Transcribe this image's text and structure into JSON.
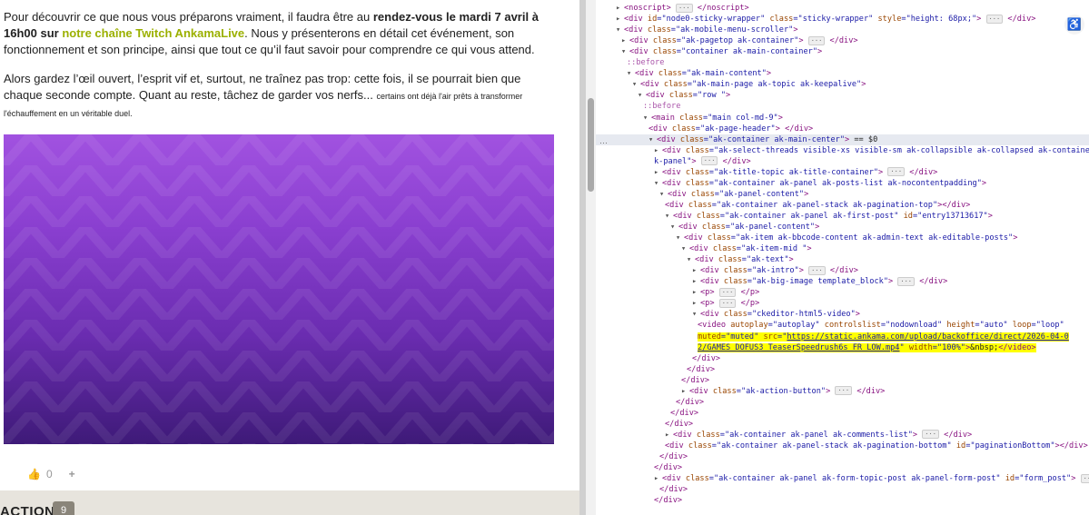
{
  "article": {
    "p1_a": "Pour découvrir ce que nous vous préparons vraiment, il faudra être au ",
    "p1_bold": "rendez-vous le mardi 7 avril à 16h00 sur",
    "p1_link": " notre chaîne Twitch AnkamaLive",
    "p1_b": ". Nous y présenterons en détail cet événement, son fonctionnement et son principe, ainsi que tout ce qu’il faut savoir pour comprendre ce qui vous attend.",
    "p2_a": "Alors gardez l’œil ouvert, l’esprit vif et, surtout, ne traînez pas trop: cette fois, il se pourrait bien que chaque seconde compte. Quant au reste, tâchez de garder vos nerfs... ",
    "p2_small": "certains ont déjà l'air prêts à transformer l'échauffement en un véritable duel."
  },
  "likes": {
    "count": "0",
    "plus": "+"
  },
  "actions": {
    "label": "ACTIONS",
    "count": "9"
  },
  "devtools": {
    "lines": [
      {
        "indent": 0,
        "html": "<span class='arrow'>▸</span><span class='tag'>&lt;noscript&gt;</span> <span class='ell'>···</span> <span class='tag'>&lt;/noscript&gt;</span>"
      },
      {
        "indent": 0,
        "html": "<span class='arrow'>▸</span><span class='tag'>&lt;div</span> <span class='attr'>id</span>=<span class='val'>\"node0-sticky-wrapper\"</span> <span class='attr'>class</span>=<span class='val'>\"sticky-wrapper\"</span> <span class='attr'>style</span>=<span class='val'>\"height: 68px;\"</span><span class='tag'>&gt;</span> <span class='ell'>···</span> <span class='tag'>&lt;/div&gt;</span>"
      },
      {
        "indent": 0,
        "html": "<span class='arrow'>▾</span><span class='tag'>&lt;div</span> <span class='attr'>class</span>=<span class='val'>\"ak-mobile-menu-scroller\"</span><span class='tag'>&gt;</span>"
      },
      {
        "indent": 1,
        "html": "<span class='arrow'>▸</span><span class='tag'>&lt;div</span> <span class='attr'>class</span>=<span class='val'>\"ak-pagetop ak-container\"</span><span class='tag'>&gt;</span> <span class='ell'>···</span> <span class='tag'>&lt;/div&gt;</span>"
      },
      {
        "indent": 1,
        "html": "<span class='arrow'>▾</span><span class='tag'>&lt;div</span> <span class='attr'>class</span>=<span class='val'>\"container ak-main-container\"</span><span class='tag'>&gt;</span>"
      },
      {
        "indent": 2,
        "html": "<span class='pseudo'>::before</span>"
      },
      {
        "indent": 2,
        "html": "<span class='arrow'>▾</span><span class='tag'>&lt;div</span> <span class='attr'>class</span>=<span class='val'>\"ak-main-content\"</span><span class='tag'>&gt;</span>"
      },
      {
        "indent": 3,
        "html": "<span class='arrow'>▾</span><span class='tag'>&lt;div</span> <span class='attr'>class</span>=<span class='val'>\"ak-main-page ak-topic ak-keepalive\"</span><span class='tag'>&gt;</span>"
      },
      {
        "indent": 4,
        "html": "<span class='arrow'>▾</span><span class='tag'>&lt;div</span> <span class='attr'>class</span>=<span class='val'>\"row \"</span><span class='tag'>&gt;</span>"
      },
      {
        "indent": 5,
        "html": "<span class='pseudo'>::before</span>"
      },
      {
        "indent": 5,
        "html": "<span class='arrow'>▾</span><span class='tag'>&lt;main</span> <span class='attr'>class</span>=<span class='val'>\"main col-md-9\"</span><span class='tag'>&gt;</span>"
      },
      {
        "indent": 6,
        "html": "<span class='tag'>&lt;div</span> <span class='attr'>class</span>=<span class='val'>\"ak-page-header\"</span><span class='tag'>&gt;</span> <span class='tag'>&lt;/div&gt;</span>"
      },
      {
        "indent": 6,
        "sel": true,
        "html": "<span class='arrow'>▾</span><span class='tag'>&lt;div</span> <span class='attr'>class</span>=<span class='val'>\"ak-container ak-main-center\"</span><span class='tag'>&gt;</span> <span class='txt'>== $0</span>"
      },
      {
        "indent": 7,
        "html": "<span class='arrow'>▸</span><span class='tag'>&lt;div</span> <span class='attr'>class</span>=<span class='val'>\"ak-select-threads visible-xs visible-sm ak-collapsible ak-collapsed ak-container a</span>"
      },
      {
        "indent": 7,
        "html": "<span class='val'>k-panel\"</span><span class='tag'>&gt;</span> <span class='ell'>···</span> <span class='tag'>&lt;/div&gt;</span>"
      },
      {
        "indent": 7,
        "html": "<span class='arrow'>▸</span><span class='tag'>&lt;div</span> <span class='attr'>class</span>=<span class='val'>\"ak-title-topic ak-title-container\"</span><span class='tag'>&gt;</span> <span class='ell'>···</span> <span class='tag'>&lt;/div&gt;</span>"
      },
      {
        "indent": 7,
        "html": "<span class='arrow'>▾</span><span class='tag'>&lt;div</span> <span class='attr'>class</span>=<span class='val'>\"ak-container ak-panel ak-posts-list ak-nocontentpadding\"</span><span class='tag'>&gt;</span>"
      },
      {
        "indent": 8,
        "html": "<span class='arrow'>▾</span><span class='tag'>&lt;div</span> <span class='attr'>class</span>=<span class='val'>\"ak-panel-content\"</span><span class='tag'>&gt;</span>"
      },
      {
        "indent": 9,
        "html": "<span class='tag'>&lt;div</span> <span class='attr'>class</span>=<span class='val'>\"ak-container ak-panel-stack ak-pagination-top\"</span><span class='tag'>&gt;&lt;/div&gt;</span>"
      },
      {
        "indent": 9,
        "html": "<span class='arrow'>▾</span><span class='tag'>&lt;div</span> <span class='attr'>class</span>=<span class='val'>\"ak-container ak-panel ak-first-post\"</span> <span class='attr'>id</span>=<span class='val'>\"entry13713617\"</span><span class='tag'>&gt;</span>"
      },
      {
        "indent": 10,
        "html": "<span class='arrow'>▾</span><span class='tag'>&lt;div</span> <span class='attr'>class</span>=<span class='val'>\"ak-panel-content\"</span><span class='tag'>&gt;</span>"
      },
      {
        "indent": 11,
        "html": "<span class='arrow'>▾</span><span class='tag'>&lt;div</span> <span class='attr'>class</span>=<span class='val'>\"ak-item ak-bbcode-content ak-admin-text ak-editable-posts\"</span><span class='tag'>&gt;</span>"
      },
      {
        "indent": 12,
        "html": "<span class='arrow'>▾</span><span class='tag'>&lt;div</span> <span class='attr'>class</span>=<span class='val'>\"ak-item-mid \"</span><span class='tag'>&gt;</span>"
      },
      {
        "indent": 13,
        "html": "<span class='arrow'>▾</span><span class='tag'>&lt;div</span> <span class='attr'>class</span>=<span class='val'>\"ak-text\"</span><span class='tag'>&gt;</span>"
      },
      {
        "indent": 14,
        "html": "<span class='arrow'>▸</span><span class='tag'>&lt;div</span> <span class='attr'>class</span>=<span class='val'>\"ak-intro\"</span><span class='tag'>&gt;</span> <span class='ell'>···</span> <span class='tag'>&lt;/div&gt;</span>"
      },
      {
        "indent": 14,
        "html": "<span class='arrow'>▸</span><span class='tag'>&lt;div</span> <span class='attr'>class</span>=<span class='val'>\"ak-big-image template_block\"</span><span class='tag'>&gt;</span> <span class='ell'>···</span> <span class='tag'>&lt;/div&gt;</span>"
      },
      {
        "indent": 14,
        "html": "<span class='arrow'>▸</span><span class='tag'>&lt;p&gt;</span> <span class='ell'>···</span> <span class='tag'>&lt;/p&gt;</span>"
      },
      {
        "indent": 14,
        "html": "<span class='arrow'>▸</span><span class='tag'>&lt;p&gt;</span> <span class='ell'>···</span> <span class='tag'>&lt;/p&gt;</span>"
      },
      {
        "indent": 14,
        "html": "<span class='arrow'>▾</span><span class='tag'>&lt;div</span> <span class='attr'>class</span>=<span class='val'>\"ckeditor-html5-video\"</span><span class='tag'>&gt;</span>"
      },
      {
        "indent": 15,
        "html": "<span class='tag'>&lt;video</span> <span class='attr'>autoplay</span>=<span class='val'>\"autoplay\"</span> <span class='attr'>controlslist</span>=<span class='val'>\"nodownload\"</span> <span class='attr'>height</span>=<span class='val'>\"auto\"</span> <span class='attr'>loop</span>=<span class='val'>\"loop\"</span>"
      },
      {
        "indent": 15,
        "hl": true,
        "html": "<span class='attr'>muted</span>=<span class='val'>\"muted\"</span> <span class='attr'>src</span>=<span class='val'>\"<span class='ul'>https://static.ankama.com/upload/backoffice/direct/2026-04-0</span></span>"
      },
      {
        "indent": 15,
        "hl": true,
        "html": "<span class='val'><span class='ul'>2/GAMES_DOFUS3_TeaserSpeedrush6s_FR_LOW.mp4</span>\"</span> <span class='attr'>width</span>=<span class='val'>\"100%\"</span><span class='tag'>&gt;</span><span class='txt'>&amp;nbsp;</span><span class='tag'>&lt;/video&gt;</span>"
      },
      {
        "indent": 14,
        "html": "<span class='tag'>&lt;/div&gt;</span>"
      },
      {
        "indent": 13,
        "html": "<span class='tag'>&lt;/div&gt;</span>"
      },
      {
        "indent": 12,
        "html": "<span class='tag'>&lt;/div&gt;</span>"
      },
      {
        "indent": 12,
        "html": "<span class='arrow'>▸</span><span class='tag'>&lt;div</span> <span class='attr'>class</span>=<span class='val'>\"ak-action-button\"</span><span class='tag'>&gt;</span> <span class='ell'>···</span> <span class='tag'>&lt;/div&gt;</span>"
      },
      {
        "indent": 11,
        "html": "<span class='tag'>&lt;/div&gt;</span>"
      },
      {
        "indent": 10,
        "html": "<span class='tag'>&lt;/div&gt;</span>"
      },
      {
        "indent": 9,
        "html": "<span class='tag'>&lt;/div&gt;</span>"
      },
      {
        "indent": 9,
        "html": "<span class='arrow'>▸</span><span class='tag'>&lt;div</span> <span class='attr'>class</span>=<span class='val'>\"ak-container ak-panel ak-comments-list\"</span><span class='tag'>&gt;</span> <span class='ell'>···</span> <span class='tag'>&lt;/div&gt;</span>"
      },
      {
        "indent": 9,
        "html": "<span class='tag'>&lt;div</span> <span class='attr'>class</span>=<span class='val'>\"ak-container ak-panel-stack ak-pagination-bottom\"</span> <span class='attr'>id</span>=<span class='val'>\"paginationBottom\"</span><span class='tag'>&gt;&lt;/div&gt;</span>"
      },
      {
        "indent": 8,
        "html": "<span class='tag'>&lt;/div&gt;</span>"
      },
      {
        "indent": 7,
        "html": "<span class='tag'>&lt;/div&gt;</span>"
      },
      {
        "indent": 7,
        "html": "<span class='arrow'>▸</span><span class='tag'>&lt;div</span> <span class='attr'>class</span>=<span class='val'>\"ak-container ak-panel ak-form-topic-post ak-panel-form-post\"</span> <span class='attr'>id</span>=<span class='val'>\"form_post\"</span><span class='tag'>&gt;</span> <span class='ell'>···</span>"
      },
      {
        "indent": 8,
        "html": "<span class='tag'>&lt;/div&gt;</span>"
      },
      {
        "indent": 7,
        "html": "<span class='tag'>&lt;/div&gt;</span>"
      }
    ]
  }
}
